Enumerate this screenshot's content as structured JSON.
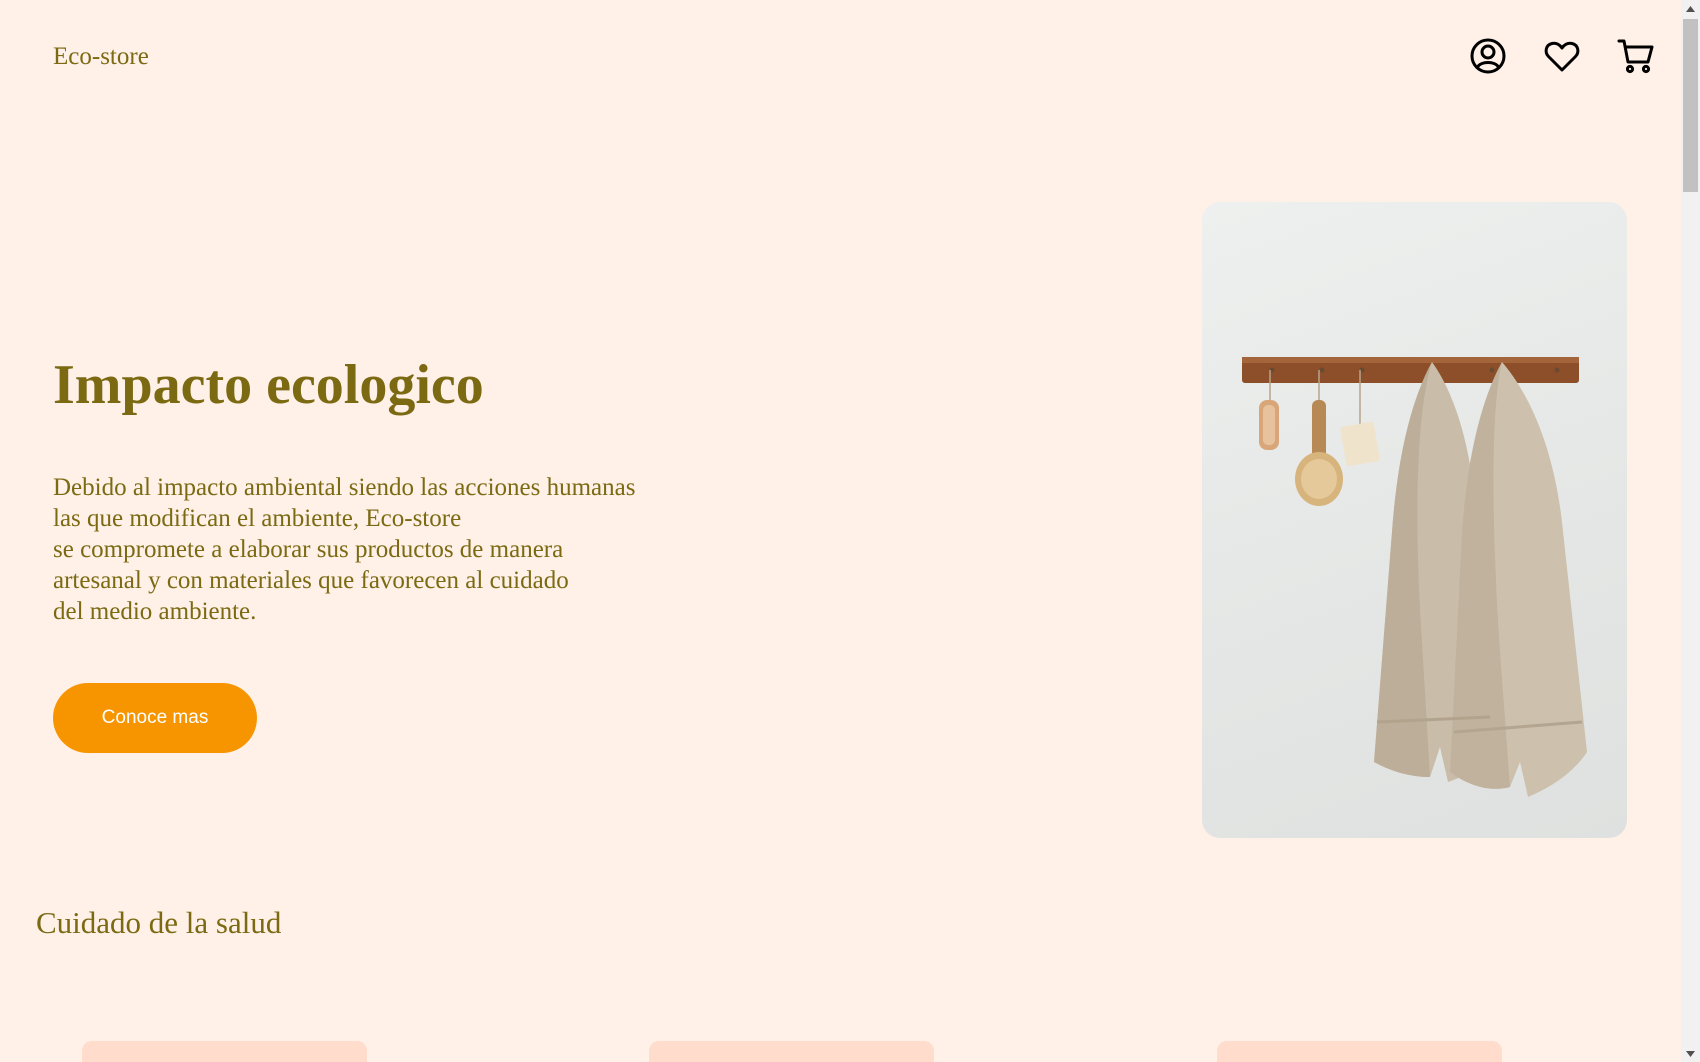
{
  "header": {
    "brand": "Eco-store",
    "icons": [
      "user-icon",
      "heart-icon",
      "cart-icon"
    ]
  },
  "hero": {
    "title": "Impacto ecologico",
    "description_lines": [
      "Debido al impacto ambiental siendo las acciones humanas",
      "las que modifican el ambiente, Eco-store",
      "se compromete a elaborar sus productos de manera",
      "artesanal y con materiales que favorecen al cuidado",
      "del medio ambiente."
    ],
    "button_label": "Conoce mas",
    "image_alt": "towels-hanging-on-rack"
  },
  "section": {
    "title": "Cuidado de la salud"
  },
  "colors": {
    "background": "#fff0e8",
    "text": "#7b6a12",
    "button": "#f79500",
    "card": "#ffdccb"
  }
}
